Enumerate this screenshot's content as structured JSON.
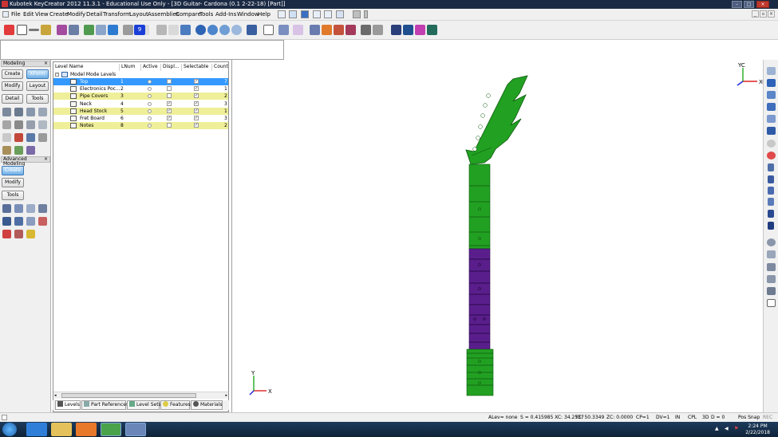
{
  "window": {
    "title": "Kubotek KeyCreator 2012 11.3.1 - Educational Use Only - [3D Guitar- Cardona (0.1 2-22-18) [Part]]"
  },
  "menu": [
    "File",
    "Edit",
    "View",
    "Create",
    "Modify",
    "Detail",
    "Transform",
    "Layout",
    "Assemblies",
    "Compare",
    "Tools",
    "Add-Ins",
    "Window",
    "Help"
  ],
  "toolbar": {
    "level_field": "9"
  },
  "modeling_panel": {
    "title": "Modeling",
    "buttons": [
      "Create",
      "XForm",
      "Modify",
      "Layout",
      "Detail",
      "Tools"
    ],
    "active": "XForm"
  },
  "advanced_panel": {
    "title": "Advanced Modeling",
    "buttons": [
      "Create",
      "Modify",
      "Tools"
    ],
    "active": "Create"
  },
  "levels": {
    "columns": [
      "Level Name",
      "LNum",
      "Active",
      "Displ...",
      "Selectable",
      "Count"
    ],
    "root": "Model Mode Levels",
    "rows": [
      {
        "name": "Top",
        "num": "1",
        "count": "7",
        "displayed": false,
        "selectable": true,
        "highlight": false,
        "selected": true
      },
      {
        "name": "Electronics Poc...",
        "num": "2",
        "count": "1",
        "displayed": false,
        "selectable": true,
        "highlight": false,
        "selected": false
      },
      {
        "name": "Pipe Covers",
        "num": "3",
        "count": "2",
        "displayed": false,
        "selectable": true,
        "highlight": true,
        "selected": false
      },
      {
        "name": "Neck",
        "num": "4",
        "count": "3",
        "displayed": true,
        "selectable": true,
        "highlight": false,
        "selected": false
      },
      {
        "name": "Head Stock",
        "num": "5",
        "count": "1",
        "displayed": true,
        "selectable": true,
        "highlight": true,
        "selected": false
      },
      {
        "name": "Fret Board",
        "num": "6",
        "count": "3",
        "displayed": true,
        "selectable": true,
        "highlight": false,
        "selected": false
      },
      {
        "name": "Notes",
        "num": "8",
        "count": "2",
        "displayed": false,
        "selectable": true,
        "highlight": true,
        "selected": false
      }
    ]
  },
  "bottom_tabs": [
    "Levels",
    "Part References",
    "Level Sets",
    "Features",
    "Materials"
  ],
  "viewport": {
    "triad_top": {
      "x": "XC",
      "y": "YC"
    },
    "triad_bottom": {
      "x": "X",
      "y": "Y"
    }
  },
  "status": {
    "alev": "ALev= none",
    "scale": "S = 0.415985 XC: 34.2537",
    "yc": "YC: 50.3349",
    "zc": "ZC: 0.0000",
    "cp": "CP=1",
    "dv": "DV=1",
    "units": "IN",
    "cpl": "CPL",
    "dim": "3D",
    "d": "D = 0",
    "possnap": "Pos Snap",
    "rec": "REC"
  },
  "clock": {
    "time": "2:24 PM",
    "date": "2/22/2018"
  },
  "colors": {
    "green": "#22a022",
    "purple": "#5a1e8c",
    "titlebar": "#1b2a44"
  }
}
